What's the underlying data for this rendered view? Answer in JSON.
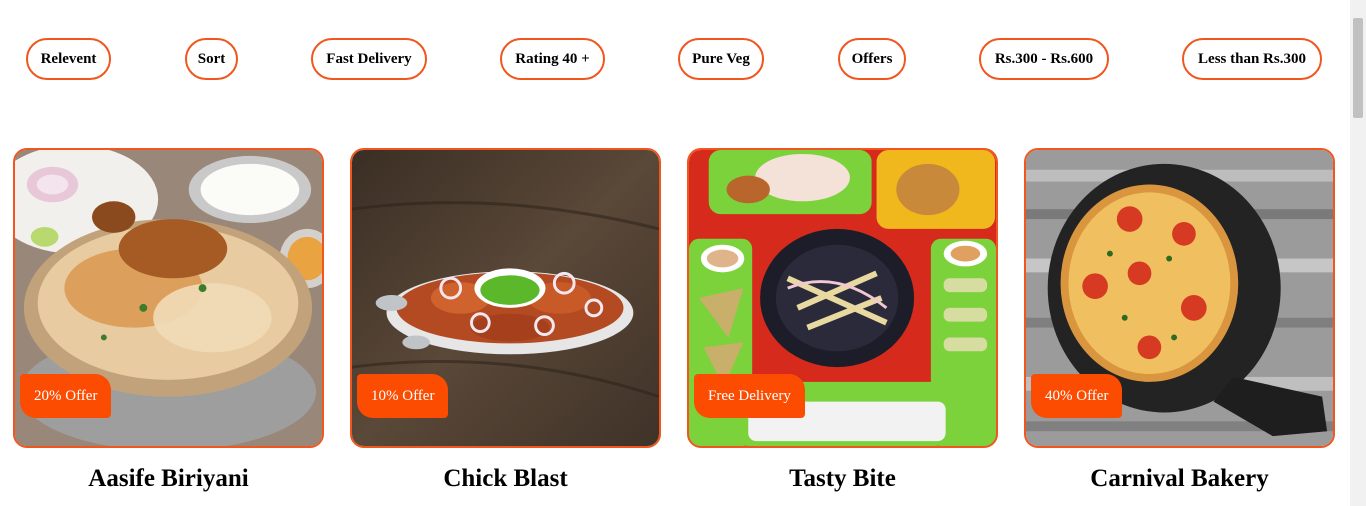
{
  "filters": [
    {
      "label": "Relevent"
    },
    {
      "label": "Sort"
    },
    {
      "label": "Fast Delivery"
    },
    {
      "label": "Rating 40 +"
    },
    {
      "label": "Pure Veg"
    },
    {
      "label": "Offers"
    },
    {
      "label": "Rs.300 - Rs.600"
    },
    {
      "label": "Less than Rs.300"
    }
  ],
  "restaurants": [
    {
      "name": "Aasife Biriyani",
      "offer": "20% Offer",
      "image": "biryani-photo"
    },
    {
      "name": "Chick Blast",
      "offer": "10% Offer",
      "image": "tandoori-chicken-photo"
    },
    {
      "name": "Tasty Bite",
      "offer": "Free Delivery",
      "image": "fast-food-platter-photo"
    },
    {
      "name": "Carnival Bakery",
      "offer": "40% Offer",
      "image": "pizza-photo"
    }
  ],
  "colors": {
    "accent": "#f0561d",
    "badge": "#fc4c02",
    "badge_text": "#ffffff"
  }
}
